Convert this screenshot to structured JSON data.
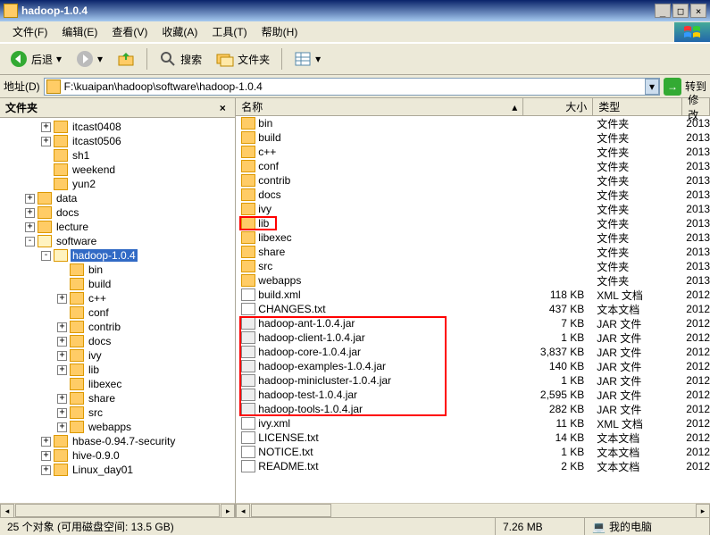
{
  "title": "hadoop-1.0.4",
  "menu": [
    "文件(F)",
    "编辑(E)",
    "查看(V)",
    "收藏(A)",
    "工具(T)",
    "帮助(H)"
  ],
  "toolbar": {
    "back": "后退",
    "search": "搜索",
    "folders": "文件夹"
  },
  "address": {
    "label": "地址(D)",
    "path": "F:\\kuaipan\\hadoop\\software\\hadoop-1.0.4",
    "go": "转到"
  },
  "left": {
    "title": "文件夹",
    "nodes": [
      {
        "d": 2,
        "e": "+",
        "n": "itcast0408"
      },
      {
        "d": 2,
        "e": "+",
        "n": "itcast0506"
      },
      {
        "d": 2,
        "e": " ",
        "n": "sh1"
      },
      {
        "d": 2,
        "e": " ",
        "n": "weekend"
      },
      {
        "d": 2,
        "e": " ",
        "n": "yun2"
      },
      {
        "d": 1,
        "e": "+",
        "n": "data"
      },
      {
        "d": 1,
        "e": "+",
        "n": "docs"
      },
      {
        "d": 1,
        "e": "+",
        "n": "lecture"
      },
      {
        "d": 1,
        "e": "-",
        "n": "software",
        "open": true
      },
      {
        "d": 2,
        "e": "-",
        "n": "hadoop-1.0.4",
        "sel": true,
        "open": true
      },
      {
        "d": 3,
        "e": " ",
        "n": "bin"
      },
      {
        "d": 3,
        "e": " ",
        "n": "build"
      },
      {
        "d": 3,
        "e": "+",
        "n": "c++"
      },
      {
        "d": 3,
        "e": " ",
        "n": "conf"
      },
      {
        "d": 3,
        "e": "+",
        "n": "contrib"
      },
      {
        "d": 3,
        "e": "+",
        "n": "docs"
      },
      {
        "d": 3,
        "e": "+",
        "n": "ivy"
      },
      {
        "d": 3,
        "e": "+",
        "n": "lib"
      },
      {
        "d": 3,
        "e": " ",
        "n": "libexec"
      },
      {
        "d": 3,
        "e": "+",
        "n": "share"
      },
      {
        "d": 3,
        "e": "+",
        "n": "src"
      },
      {
        "d": 3,
        "e": "+",
        "n": "webapps"
      },
      {
        "d": 2,
        "e": "+",
        "n": "hbase-0.94.7-security"
      },
      {
        "d": 2,
        "e": "+",
        "n": "hive-0.9.0"
      },
      {
        "d": 2,
        "e": "+",
        "n": "Linux_day01"
      }
    ]
  },
  "cols": {
    "name": "名称",
    "size": "大小",
    "type": "类型",
    "mod": "修改"
  },
  "files": [
    {
      "ic": "folder",
      "n": "bin",
      "s": "",
      "t": "文件夹",
      "m": "2013"
    },
    {
      "ic": "folder",
      "n": "build",
      "s": "",
      "t": "文件夹",
      "m": "2013"
    },
    {
      "ic": "folder",
      "n": "c++",
      "s": "",
      "t": "文件夹",
      "m": "2013"
    },
    {
      "ic": "folder",
      "n": "conf",
      "s": "",
      "t": "文件夹",
      "m": "2013"
    },
    {
      "ic": "folder",
      "n": "contrib",
      "s": "",
      "t": "文件夹",
      "m": "2013"
    },
    {
      "ic": "folder",
      "n": "docs",
      "s": "",
      "t": "文件夹",
      "m": "2013"
    },
    {
      "ic": "folder",
      "n": "ivy",
      "s": "",
      "t": "文件夹",
      "m": "2013"
    },
    {
      "ic": "folder",
      "n": "lib",
      "s": "",
      "t": "文件夹",
      "m": "2013"
    },
    {
      "ic": "folder",
      "n": "libexec",
      "s": "",
      "t": "文件夹",
      "m": "2013"
    },
    {
      "ic": "folder",
      "n": "share",
      "s": "",
      "t": "文件夹",
      "m": "2013"
    },
    {
      "ic": "folder",
      "n": "src",
      "s": "",
      "t": "文件夹",
      "m": "2013"
    },
    {
      "ic": "folder",
      "n": "webapps",
      "s": "",
      "t": "文件夹",
      "m": "2013"
    },
    {
      "ic": "xml",
      "n": "build.xml",
      "s": "118 KB",
      "t": "XML 文档",
      "m": "2012"
    },
    {
      "ic": "txt",
      "n": "CHANGES.txt",
      "s": "437 KB",
      "t": "文本文档",
      "m": "2012"
    },
    {
      "ic": "jar",
      "n": "hadoop-ant-1.0.4.jar",
      "s": "7 KB",
      "t": "JAR 文件",
      "m": "2012"
    },
    {
      "ic": "jar",
      "n": "hadoop-client-1.0.4.jar",
      "s": "1 KB",
      "t": "JAR 文件",
      "m": "2012"
    },
    {
      "ic": "jar",
      "n": "hadoop-core-1.0.4.jar",
      "s": "3,837 KB",
      "t": "JAR 文件",
      "m": "2012"
    },
    {
      "ic": "jar",
      "n": "hadoop-examples-1.0.4.jar",
      "s": "140 KB",
      "t": "JAR 文件",
      "m": "2012"
    },
    {
      "ic": "jar",
      "n": "hadoop-minicluster-1.0.4.jar",
      "s": "1 KB",
      "t": "JAR 文件",
      "m": "2012"
    },
    {
      "ic": "jar",
      "n": "hadoop-test-1.0.4.jar",
      "s": "2,595 KB",
      "t": "JAR 文件",
      "m": "2012"
    },
    {
      "ic": "jar",
      "n": "hadoop-tools-1.0.4.jar",
      "s": "282 KB",
      "t": "JAR 文件",
      "m": "2012"
    },
    {
      "ic": "xml",
      "n": "ivy.xml",
      "s": "11 KB",
      "t": "XML 文档",
      "m": "2012"
    },
    {
      "ic": "txt",
      "n": "LICENSE.txt",
      "s": "14 KB",
      "t": "文本文档",
      "m": "2012"
    },
    {
      "ic": "txt",
      "n": "NOTICE.txt",
      "s": "1 KB",
      "t": "文本文档",
      "m": "2012"
    },
    {
      "ic": "txt",
      "n": "README.txt",
      "s": "2 KB",
      "t": "文本文档",
      "m": "2012"
    }
  ],
  "status": {
    "left": "25 个对象 (可用磁盘空间: 13.5 GB)",
    "size": "7.26 MB",
    "loc": "我的电脑"
  }
}
